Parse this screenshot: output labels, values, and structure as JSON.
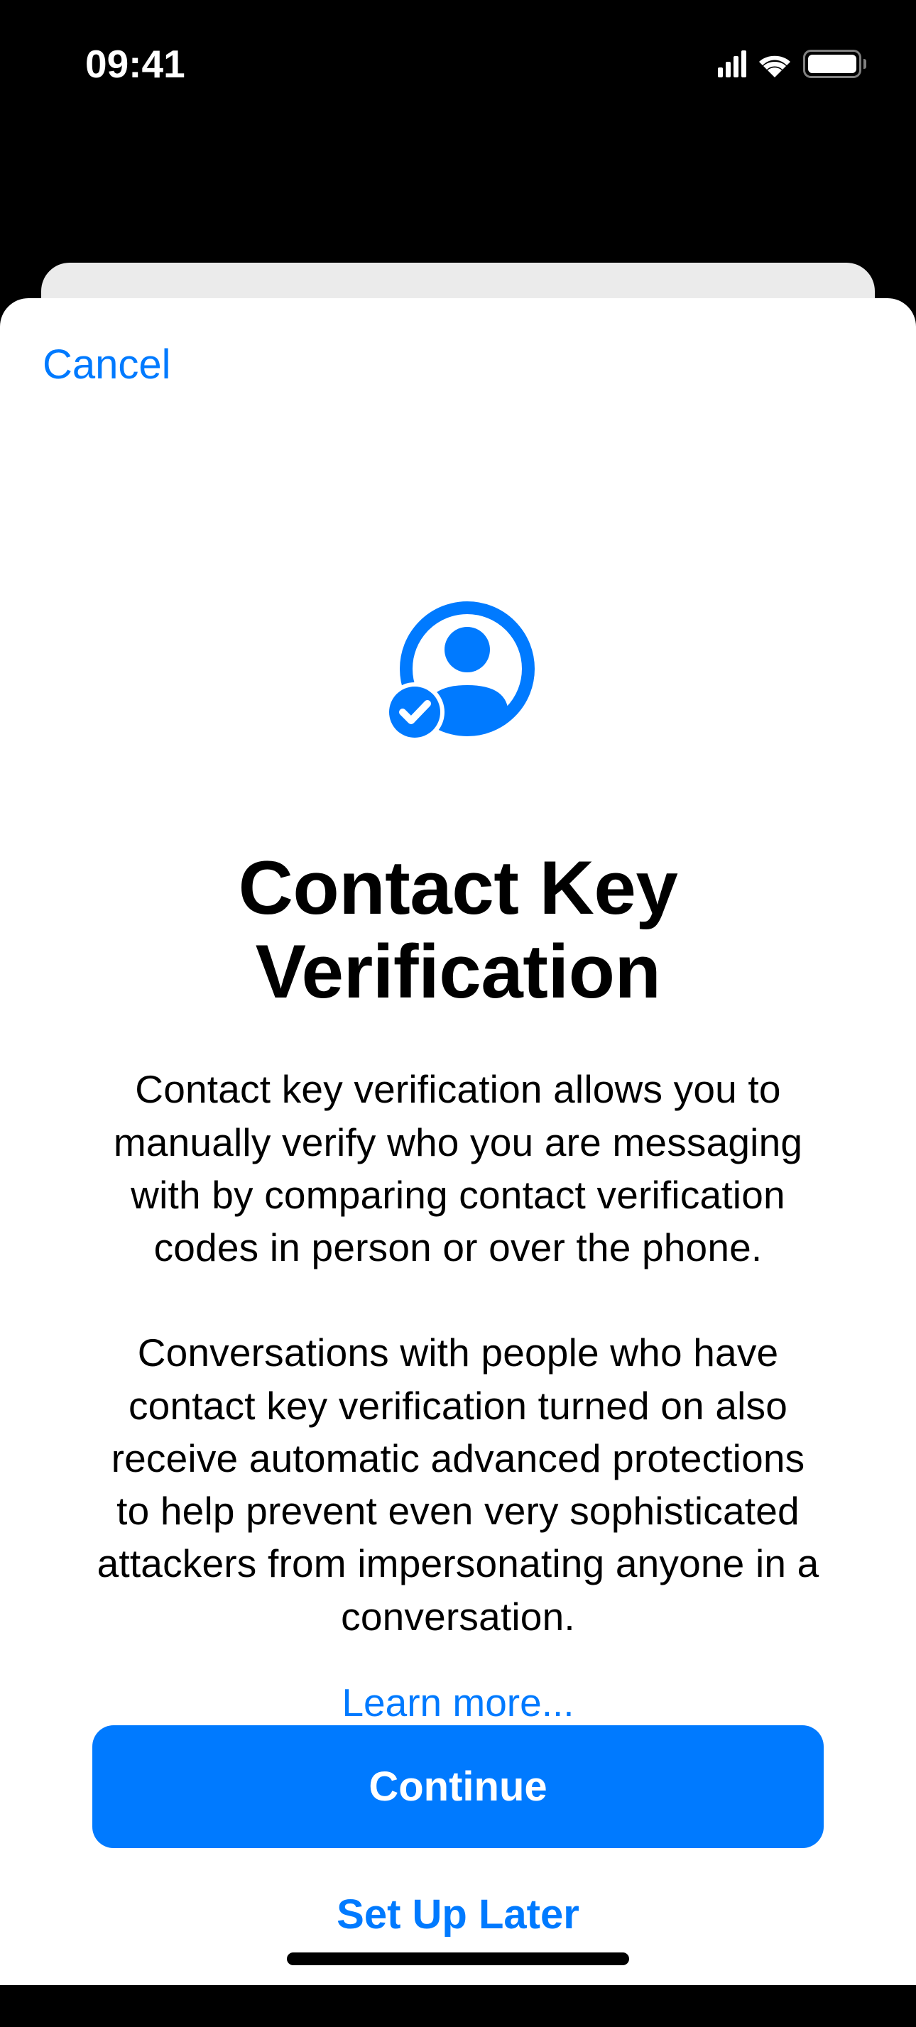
{
  "statusBar": {
    "time": "09:41"
  },
  "sheet": {
    "cancel": "Cancel",
    "title": "Contact Key Verification",
    "paragraph1": "Contact key verification allows you to manually verify who you are messaging with by comparing contact verification codes in person or over the phone.",
    "paragraph2": "Conversations with people who have contact key verification turned on also receive automatic advanced protections to help prevent even very sophisticated attackers from impersonating anyone in a conversation.",
    "learnMore": "Learn more...",
    "continue": "Continue",
    "setUpLater": "Set Up Later"
  },
  "colors": {
    "accent": "#007AFF"
  }
}
